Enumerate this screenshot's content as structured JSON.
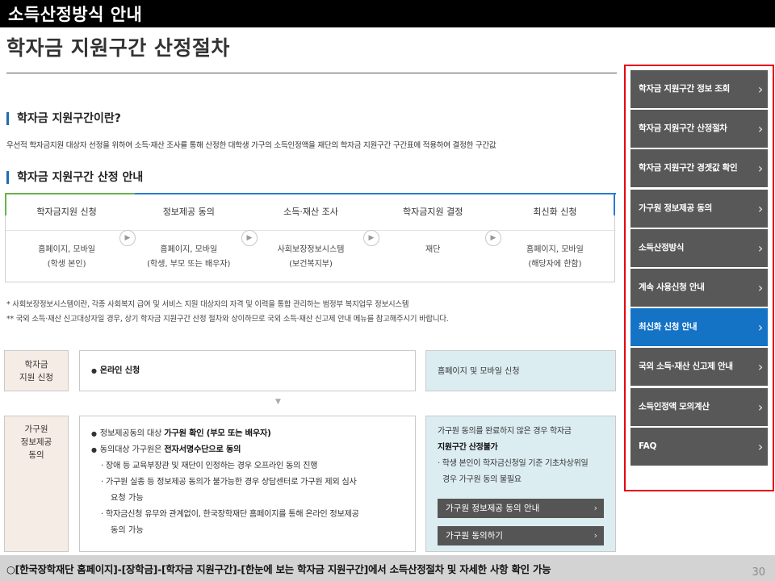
{
  "header": {
    "banner": "소득산정방식 안내",
    "title": "학자금 지원구간 산정절차"
  },
  "section1": {
    "title": "학자금 지원구간이란?",
    "description": "우선적 학자금지원 대상자 선정을 위하여 소득·재산 조사를 통해 산정한 대학생 가구의 소득인정액을 재단의 학자금 지원구간 구간표에 적용하여 결정한 구간값"
  },
  "section2": {
    "title": "학자금 지원구간 산정 안내",
    "steps": [
      {
        "head": "학자금지원 신청",
        "line1": "홈페이지, 모바일",
        "line2": "(학생 본인)"
      },
      {
        "head": "정보제공 동의",
        "line1": "홈페이지, 모바일",
        "line2": "(학생, 부모 또는 배우자)"
      },
      {
        "head": "소득·재산 조사",
        "line1": "사회보장정보시스템",
        "line2": "(보건복지부)"
      },
      {
        "head": "학자금지원 결정",
        "line1": "재단",
        "line2": ""
      },
      {
        "head": "최신화 신청",
        "line1": "홈페이지, 모바일",
        "line2": "(해당자에 한함)"
      }
    ],
    "note1": "* 사회보장정보시스템이란, 각종 사회복지 급여 및 서비스 지원 대상자의 자격 및 이력을 통합 관리하는 범정부 복지업무 정보시스템",
    "note2": "** 국외 소득·재산 신고대상자일 경우, 상기 학자금 지원구간 산정 절차와 상이하므로 국외 소득·재산 신고제 안내 메뉴를 참고해주시기 바랍니다."
  },
  "apply": {
    "label_line1": "학자금",
    "label_line2": "지원 신청",
    "bullet": "온라인 신청",
    "side": "홈페이지 및 모바일 신청"
  },
  "consent": {
    "label_line1": "가구원",
    "label_line2": "정보제공",
    "label_line3": "동의",
    "b1_pre": "정보제공동의 대상 ",
    "b1_strong": "가구원 확인 (부모 또는 배우자)",
    "b2_pre": "동의대상 가구원은 ",
    "b2_strong": "전자서명수단으로 동의",
    "s1": "장애 등 교육부장관 및 재단이 인정하는 경우 오프라인 동의 진행",
    "s2a": "가구원 실종 등 정보제공 동의가 불가능한 경우 상담센터로 가구원 제외 심사",
    "s2b": "요청 가능",
    "s3a": "학자금신청 유무와 관계없이, 한국장학재단 홈페이지를 통해 온라인 정보제공",
    "s3b": "동의 가능",
    "side_line1": "가구원 동의를 완료하지 않은 경우 학자금",
    "side_line2": "지원구간 산정불가",
    "side_line3": "학생 본인이 학자금신청일 기준 기초차상위일",
    "side_line4": "경우 가구원 동의 불필요",
    "btn1": "가구원 정보제공 동의 안내",
    "btn2": "가구원 동의하기"
  },
  "menu": [
    {
      "label": "학자금 지원구간 정보 조회",
      "active": false
    },
    {
      "label": "학자금 지원구간 산정절차",
      "active": false
    },
    {
      "label": "학자금 지원구간 경곗값 확인",
      "active": false
    },
    {
      "label": "가구원 정보제공 동의",
      "active": false
    },
    {
      "label": "소득산정방식",
      "active": false
    },
    {
      "label": "계속 사용신청 안내",
      "active": false
    },
    {
      "label": "최신화 신청 안내",
      "active": true
    },
    {
      "label": "국외 소득·재산 신고제 안내",
      "active": false
    },
    {
      "label": "소득인정액 모의계산",
      "active": false
    },
    {
      "label": "FAQ",
      "active": false
    }
  ],
  "footer": {
    "text": "○[한국장학재단 홈페이지]-[장학금]-[학자금 지원구간]-[한눈에 보는 학자금 지원구간]에서 소득산정절차 및 자세한 사항 확인 가능",
    "page": "30"
  },
  "colors": {
    "accent": "#1573c6",
    "menu": "#585858",
    "highlight": "#e60012",
    "green": "#6ab04c"
  }
}
